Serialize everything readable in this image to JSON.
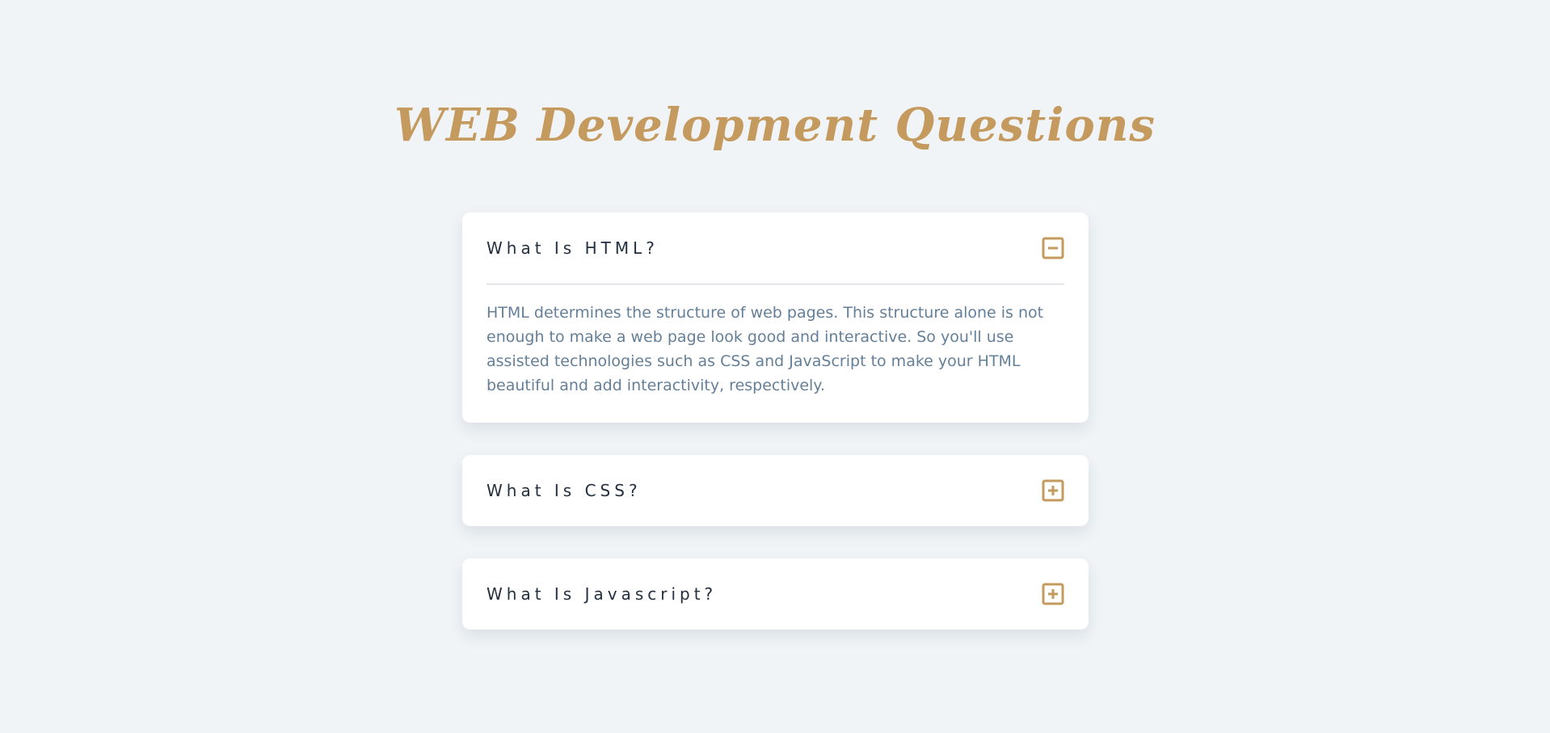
{
  "page": {
    "title": "WEB Development Questions"
  },
  "colors": {
    "background": "#f0f4f7",
    "accent": "#c49a5e",
    "question_text": "#22303f",
    "answer_text": "#647f98",
    "card": "#ffffff"
  },
  "faq": [
    {
      "question": "What Is HTML?",
      "expanded": true,
      "toggle_icon": "minus-square-icon",
      "answer": "HTML determines the structure of web pages. This structure alone is not enough to make a web page look good and interactive. So you'll use assisted technologies such as CSS and JavaScript to make your HTML beautiful and add interactivity, respectively."
    },
    {
      "question": "What Is CSS?",
      "expanded": false,
      "toggle_icon": "plus-square-icon"
    },
    {
      "question": "What Is Javascript?",
      "expanded": false,
      "toggle_icon": "plus-square-icon"
    }
  ]
}
